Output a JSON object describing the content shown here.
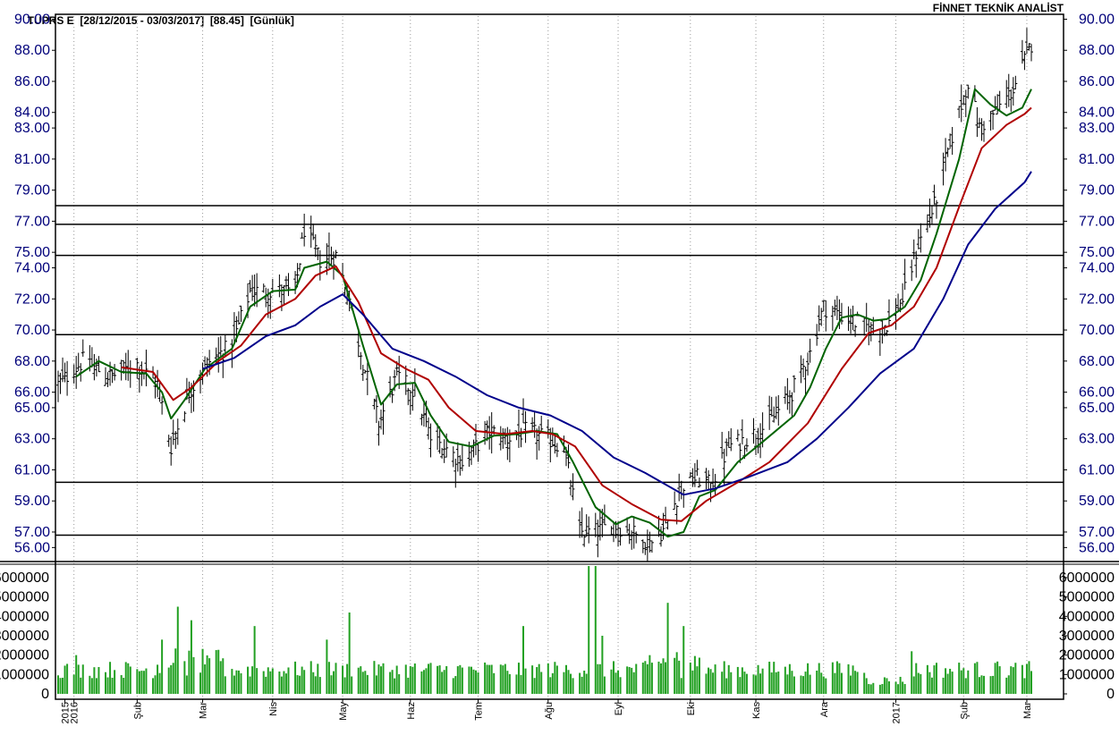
{
  "header": {
    "ticker": "TUPRS E",
    "range": "[28/12/2015 - 03/03/2017]",
    "last": "[88.45]",
    "period": "[Günlük]",
    "brand": "FİNNET TEKNİK ANALİST"
  },
  "colors": {
    "price_bars": "#000000",
    "short_ma": "#006400",
    "mid_ma": "#b00000",
    "long_ma": "#00008b",
    "volume": "#22a022",
    "levels": "#000000",
    "price_axis_text": "#00007a"
  },
  "chart_data": [
    {
      "type": "candlestick",
      "title": "TUPRS E [28/12/2015 - 03/03/2017] [88.45] [Günlük]",
      "price_axis_ticks": [
        "90.00",
        "88.00",
        "86.00",
        "84.00",
        "83.00",
        "81.00",
        "79.00",
        "77.00",
        "75.00",
        "74.00",
        "72.00",
        "70.00",
        "68.00",
        "66.00",
        "65.00",
        "63.00",
        "61.00",
        "59.00",
        "57.00",
        "56.00"
      ],
      "ylim": [
        55.1,
        90.2
      ],
      "x_tick_labels": [
        "2015",
        "2016",
        "Şub",
        "Mar",
        "Nis",
        "May",
        "Haz",
        "Tem",
        "Ağu",
        "Eyl",
        "Eki",
        "Kas",
        "Ara",
        "2017",
        "Şub",
        "Mar"
      ],
      "horizontal_levels": [
        78.0,
        76.8,
        74.8,
        69.7,
        60.2,
        56.8
      ],
      "close_anchors": {
        "x": [
          "2015-12-28",
          "2016-01-08",
          "2016-01-20",
          "2016-02-01",
          "2016-02-10",
          "2016-02-16",
          "2016-02-24",
          "2016-03-04",
          "2016-03-14",
          "2016-03-22",
          "2016-04-01",
          "2016-04-11",
          "2016-04-15",
          "2016-04-22",
          "2016-04-29",
          "2016-05-05",
          "2016-05-11",
          "2016-05-18",
          "2016-05-26",
          "2016-06-03",
          "2016-06-10",
          "2016-06-16",
          "2016-06-24",
          "2016-07-06",
          "2016-07-14",
          "2016-07-22",
          "2016-08-01",
          "2016-08-08",
          "2016-08-15",
          "2016-08-22",
          "2016-08-30",
          "2016-09-07",
          "2016-09-15",
          "2016-09-22",
          "2016-09-29",
          "2016-10-06",
          "2016-10-12",
          "2016-10-20",
          "2016-10-28",
          "2016-11-07",
          "2016-11-17",
          "2016-11-25",
          "2016-12-01",
          "2016-12-08",
          "2016-12-15",
          "2016-12-23",
          "2016-12-30",
          "2017-01-05",
          "2017-01-12",
          "2017-01-19",
          "2017-01-26",
          "2017-02-03",
          "2017-02-08",
          "2017-02-15",
          "2017-02-23",
          "2017-03-03"
        ],
        "y": [
          66.5,
          68.0,
          67.0,
          67.8,
          66.5,
          62.5,
          66.0,
          68.0,
          69.0,
          72.5,
          72.5,
          72.5,
          76.5,
          74.5,
          74.8,
          72.0,
          68.0,
          64.0,
          67.0,
          66.0,
          63.0,
          62.5,
          61.5,
          63.5,
          63.0,
          63.5,
          63.0,
          62.5,
          57.0,
          57.0,
          57.5,
          57.0,
          56.2,
          57.3,
          60.0,
          60.5,
          60.0,
          62.5,
          63.0,
          64.0,
          66.0,
          68.5,
          71.5,
          71.0,
          70.5,
          70.0,
          70.5,
          72.0,
          75.5,
          78.0,
          82.0,
          86.0,
          83.0,
          84.0,
          85.5,
          88.45
        ]
      },
      "moving_averages": [
        {
          "points": [
            [
              "2016-01-05",
              67.0
            ],
            [
              "2016-01-15",
              68.0
            ],
            [
              "2016-01-25",
              67.3
            ],
            [
              "2016-02-05",
              67.2
            ],
            [
              "2016-02-12",
              66.0
            ],
            [
              "2016-02-16",
              64.3
            ],
            [
              "2016-02-22",
              65.5
            ],
            [
              "2016-03-02",
              67.5
            ],
            [
              "2016-03-14",
              68.8
            ],
            [
              "2016-03-22",
              71.5
            ],
            [
              "2016-04-01",
              72.5
            ],
            [
              "2016-04-11",
              72.6
            ],
            [
              "2016-04-15",
              74.0
            ],
            [
              "2016-04-25",
              74.4
            ],
            [
              "2016-05-02",
              73.5
            ],
            [
              "2016-05-11",
              69.0
            ],
            [
              "2016-05-19",
              65.2
            ],
            [
              "2016-05-26",
              66.5
            ],
            [
              "2016-06-03",
              66.6
            ],
            [
              "2016-06-10",
              64.5
            ],
            [
              "2016-06-18",
              62.8
            ],
            [
              "2016-06-28",
              62.5
            ],
            [
              "2016-07-08",
              63.2
            ],
            [
              "2016-07-18",
              63.3
            ],
            [
              "2016-07-27",
              63.5
            ],
            [
              "2016-08-05",
              63.3
            ],
            [
              "2016-08-12",
              61.5
            ],
            [
              "2016-08-22",
              58.6
            ],
            [
              "2016-08-31",
              57.5
            ],
            [
              "2016-09-07",
              58.0
            ],
            [
              "2016-09-15",
              57.6
            ],
            [
              "2016-09-23",
              56.7
            ],
            [
              "2016-09-30",
              57.0
            ],
            [
              "2016-10-07",
              59.3
            ],
            [
              "2016-10-14",
              59.7
            ],
            [
              "2016-10-24",
              61.5
            ],
            [
              "2016-11-04",
              62.8
            ],
            [
              "2016-11-18",
              64.5
            ],
            [
              "2016-11-25",
              66.3
            ],
            [
              "2016-12-02",
              68.8
            ],
            [
              "2016-12-09",
              70.8
            ],
            [
              "2016-12-16",
              71.0
            ],
            [
              "2016-12-23",
              70.6
            ],
            [
              "2016-12-29",
              70.7
            ],
            [
              "2017-01-06",
              71.5
            ],
            [
              "2017-01-13",
              73.2
            ],
            [
              "2017-01-20",
              76.2
            ],
            [
              "2017-01-30",
              81.0
            ],
            [
              "2017-02-06",
              85.5
            ],
            [
              "2017-02-13",
              84.5
            ],
            [
              "2017-02-20",
              83.8
            ],
            [
              "2017-02-27",
              84.3
            ],
            [
              "2017-03-03",
              85.5
            ]
          ]
        },
        {
          "points": [
            [
              "2016-01-25",
              67.6
            ],
            [
              "2016-02-08",
              67.3
            ],
            [
              "2016-02-17",
              65.5
            ],
            [
              "2016-02-25",
              66.3
            ],
            [
              "2016-03-08",
              68.0
            ],
            [
              "2016-03-18",
              69.0
            ],
            [
              "2016-03-29",
              71.0
            ],
            [
              "2016-04-11",
              72.0
            ],
            [
              "2016-04-20",
              73.5
            ],
            [
              "2016-04-29",
              74.1
            ],
            [
              "2016-05-09",
              71.8
            ],
            [
              "2016-05-19",
              68.5
            ],
            [
              "2016-05-30",
              67.5
            ],
            [
              "2016-06-09",
              66.8
            ],
            [
              "2016-06-18",
              65.0
            ],
            [
              "2016-06-30",
              63.5
            ],
            [
              "2016-07-13",
              63.3
            ],
            [
              "2016-07-25",
              63.5
            ],
            [
              "2016-08-03",
              63.3
            ],
            [
              "2016-08-13",
              62.5
            ],
            [
              "2016-08-25",
              60.0
            ],
            [
              "2016-09-07",
              58.8
            ],
            [
              "2016-09-20",
              57.8
            ],
            [
              "2016-09-29",
              57.7
            ],
            [
              "2016-10-10",
              59.0
            ],
            [
              "2016-10-24",
              60.2
            ],
            [
              "2016-11-07",
              61.5
            ],
            [
              "2016-11-24",
              64.0
            ],
            [
              "2016-12-09",
              67.5
            ],
            [
              "2016-12-21",
              69.8
            ],
            [
              "2016-12-31",
              70.3
            ],
            [
              "2017-01-10",
              71.5
            ],
            [
              "2017-01-20",
              74.0
            ],
            [
              "2017-01-31",
              78.3
            ],
            [
              "2017-02-09",
              81.7
            ],
            [
              "2017-02-20",
              83.2
            ],
            [
              "2017-02-28",
              83.9
            ],
            [
              "2017-03-03",
              84.3
            ]
          ]
        },
        {
          "points": [
            [
              "2016-03-01",
              67.5
            ],
            [
              "2016-03-15",
              68.2
            ],
            [
              "2016-03-29",
              69.6
            ],
            [
              "2016-04-11",
              70.3
            ],
            [
              "2016-04-22",
              71.5
            ],
            [
              "2016-05-02",
              72.3
            ],
            [
              "2016-05-11",
              71.0
            ],
            [
              "2016-05-24",
              68.8
            ],
            [
              "2016-06-07",
              68.0
            ],
            [
              "2016-06-21",
              67.0
            ],
            [
              "2016-07-05",
              65.8
            ],
            [
              "2016-07-19",
              65.0
            ],
            [
              "2016-08-02",
              64.5
            ],
            [
              "2016-08-16",
              63.5
            ],
            [
              "2016-08-30",
              61.8
            ],
            [
              "2016-09-13",
              60.8
            ],
            [
              "2016-09-30",
              59.4
            ],
            [
              "2016-10-14",
              59.8
            ],
            [
              "2016-10-28",
              60.5
            ],
            [
              "2016-11-15",
              61.5
            ],
            [
              "2016-11-28",
              63.0
            ],
            [
              "2016-12-12",
              65.0
            ],
            [
              "2016-12-26",
              67.2
            ],
            [
              "2017-01-10",
              68.8
            ],
            [
              "2017-01-23",
              72.0
            ],
            [
              "2017-02-03",
              75.5
            ],
            [
              "2017-02-15",
              77.8
            ],
            [
              "2017-02-28",
              79.5
            ],
            [
              "2017-03-03",
              80.2
            ]
          ]
        }
      ]
    },
    {
      "type": "bar",
      "title": "",
      "volume_axis_ticks": [
        "6000000",
        "5000000",
        "4000000",
        "3000000",
        "2000000",
        "1000000",
        "0"
      ],
      "ylim": [
        0,
        6600000
      ],
      "spikes": [
        {
          "x": "2016-01-05",
          "value": 2000000
        },
        {
          "x": "2016-02-12",
          "value": 2800000
        },
        {
          "x": "2016-02-19",
          "value": 4500000
        },
        {
          "x": "2016-02-25",
          "value": 3800000
        },
        {
          "x": "2016-03-24",
          "value": 3500000
        },
        {
          "x": "2016-04-25",
          "value": 2800000
        },
        {
          "x": "2016-05-05",
          "value": 4200000
        },
        {
          "x": "2016-07-21",
          "value": 3500000
        },
        {
          "x": "2016-08-19",
          "value": 6600000
        },
        {
          "x": "2016-08-22",
          "value": 6600000
        },
        {
          "x": "2016-08-25",
          "value": 3000000
        },
        {
          "x": "2016-09-23",
          "value": 4700000
        },
        {
          "x": "2016-09-30",
          "value": 3500000
        },
        {
          "x": "2017-01-09",
          "value": 2200000
        },
        {
          "x": "2017-02-15",
          "value": 1600000
        }
      ]
    }
  ]
}
